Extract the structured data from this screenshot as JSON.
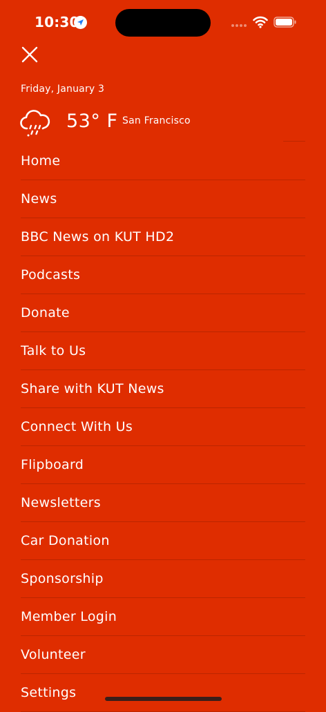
{
  "colors": {
    "background": "#df2d00",
    "text": "#ffffff",
    "accent_location": "#1f7bf5"
  },
  "status_bar": {
    "time": "10:30",
    "icons": [
      "location-arrow-icon",
      "cellular-signal-icon",
      "wifi-icon",
      "battery-icon"
    ]
  },
  "header": {
    "close_icon": "close-icon",
    "date": "Friday, January 3"
  },
  "weather": {
    "icon": "rain-cloud-icon",
    "temperature": "53° F",
    "city": "San Francisco"
  },
  "menu": {
    "items": [
      {
        "label": "Home"
      },
      {
        "label": "News"
      },
      {
        "label": "BBC News on KUT HD2"
      },
      {
        "label": "Podcasts"
      },
      {
        "label": "Donate"
      },
      {
        "label": "Talk to Us"
      },
      {
        "label": "Share with KUT News"
      },
      {
        "label": "Connect With Us"
      },
      {
        "label": "Flipboard"
      },
      {
        "label": "Newsletters"
      },
      {
        "label": "Car Donation"
      },
      {
        "label": "Sponsorship"
      },
      {
        "label": "Member Login"
      },
      {
        "label": "Volunteer"
      },
      {
        "label": "Settings"
      }
    ]
  }
}
